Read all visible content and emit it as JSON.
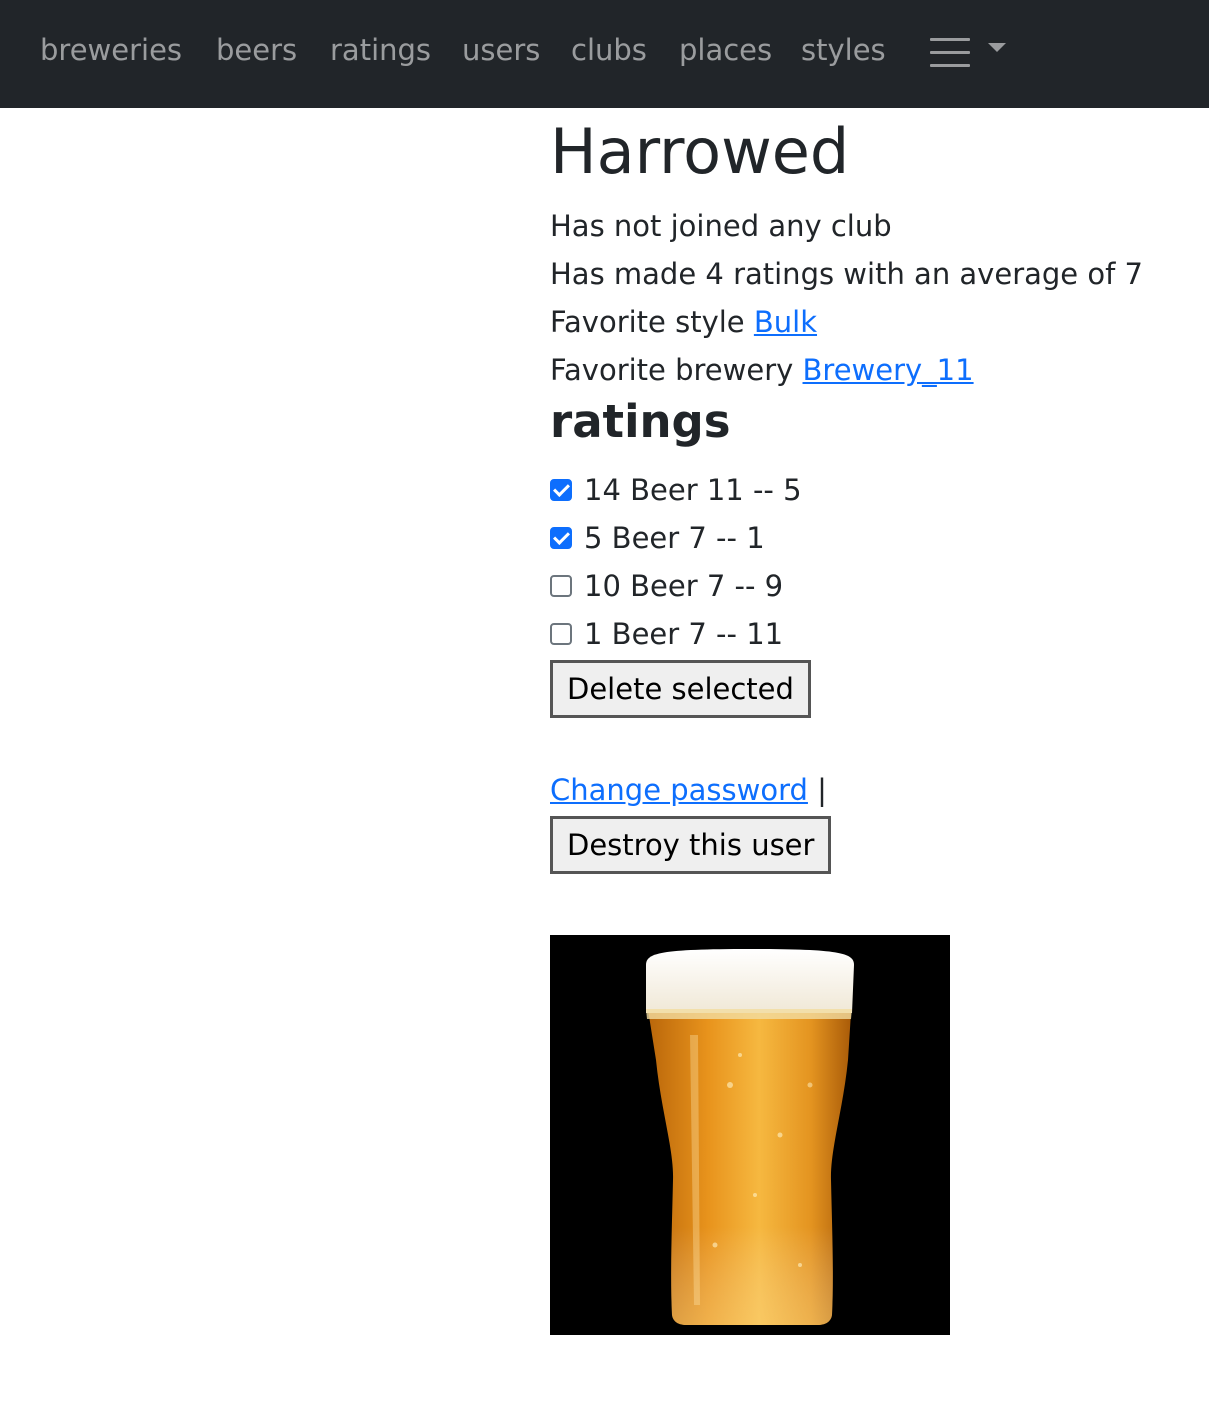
{
  "nav": {
    "items": [
      {
        "label": "breweries",
        "name": "nav-link-breweries"
      },
      {
        "label": "beers",
        "name": "nav-link-beers"
      },
      {
        "label": "ratings",
        "name": "nav-link-ratings"
      },
      {
        "label": "users",
        "name": "nav-link-users"
      },
      {
        "label": "clubs",
        "name": "nav-link-clubs"
      },
      {
        "label": "places",
        "name": "nav-link-places"
      },
      {
        "label": "styles",
        "name": "nav-link-styles"
      }
    ],
    "menu_icon": "hamburger-menu-icon",
    "dropdown_icon": "caret-down-icon"
  },
  "user": {
    "name": "Harrowed",
    "club_text": "Has not joined any club",
    "ratings_summary": "Has made 4 ratings with an average of 7",
    "favorite_style_label": "Favorite style",
    "favorite_style": "Bulk",
    "favorite_brewery_label": "Favorite brewery",
    "favorite_brewery": "Brewery_11"
  },
  "ratings": {
    "heading": "ratings",
    "items": [
      {
        "text": "14 Beer 11 -- 5",
        "checked": true
      },
      {
        "text": "5 Beer 7 -- 1",
        "checked": true
      },
      {
        "text": "10 Beer 7 -- 9",
        "checked": false
      },
      {
        "text": "1 Beer 7 -- 11",
        "checked": false
      }
    ],
    "delete_button": "Delete selected"
  },
  "actions": {
    "change_password": "Change password",
    "separator": "|",
    "destroy_button": "Destroy this user"
  },
  "image": {
    "icon": "beer-glass-image"
  }
}
